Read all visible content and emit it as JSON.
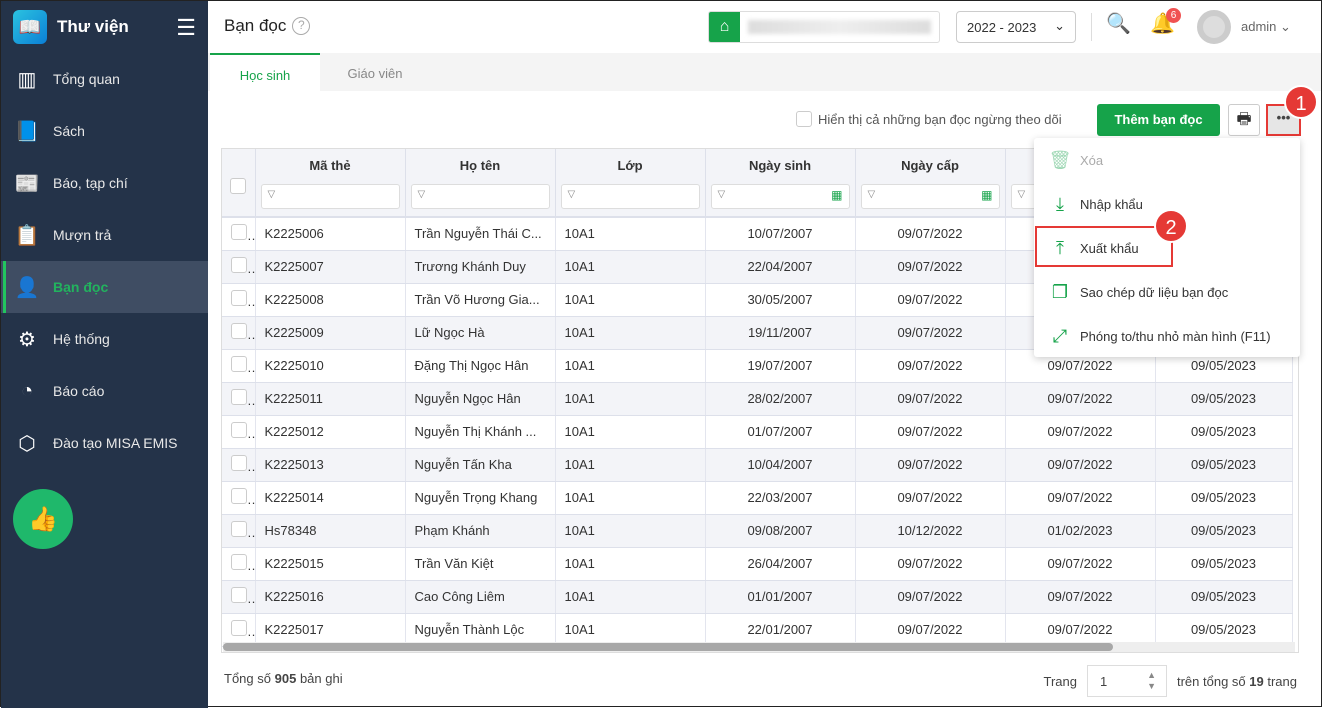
{
  "app": {
    "title": "Thư viện"
  },
  "sidebar": {
    "items": [
      {
        "label": "Tổng quan",
        "icon": "bar-chart-icon"
      },
      {
        "label": "Sách",
        "icon": "book-icon"
      },
      {
        "label": "Báo, tạp chí",
        "icon": "newspaper-icon"
      },
      {
        "label": "Mượn trả",
        "icon": "borrow-icon"
      },
      {
        "label": "Bạn đọc",
        "icon": "reader-icon",
        "active": true
      },
      {
        "label": "Hệ thống",
        "icon": "gear-icon"
      },
      {
        "label": "Báo cáo",
        "icon": "pie-chart-icon"
      },
      {
        "label": "Đào tạo MISA EMIS",
        "icon": "cube-icon"
      }
    ]
  },
  "header": {
    "title": "Bạn đọc",
    "year": "2022 - 2023",
    "notifications": "6",
    "user": "admin"
  },
  "tabs": [
    {
      "label": "Học sinh",
      "active": true
    },
    {
      "label": "Giáo viên"
    }
  ],
  "toolbar": {
    "show_inactive": "Hiển thị cả những bạn đọc ngừng theo dõi",
    "add": "Thêm bạn đọc",
    "more": "•••"
  },
  "annotations": {
    "step1": "1",
    "step2": "2"
  },
  "menu": [
    {
      "label": "Xóa",
      "icon": "trash-icon",
      "disabled": true
    },
    {
      "label": "Nhập khẩu",
      "icon": "import-icon"
    },
    {
      "label": "Xuất khẩu",
      "icon": "export-icon"
    },
    {
      "label": "Sao chép dữ liệu bạn đọc",
      "icon": "copy-icon"
    },
    {
      "label": "Phóng to/thu nhỏ màn hình (F11)",
      "icon": "expand-icon"
    }
  ],
  "table": {
    "columns": [
      "Mã thẻ",
      "Họ tên",
      "Lớp",
      "Ngày sinh",
      "Ngày cấp",
      "",
      ""
    ],
    "rows": [
      [
        "K2225006",
        "Trần Nguyễn Thái C...",
        "10A1",
        "10/07/2007",
        "09/07/2022",
        "",
        ""
      ],
      [
        "K2225007",
        "Trương Khánh Duy",
        "10A1",
        "22/04/2007",
        "09/07/2022",
        "",
        ""
      ],
      [
        "K2225008",
        "Trần Võ Hương Gia...",
        "10A1",
        "30/05/2007",
        "09/07/2022",
        "",
        ""
      ],
      [
        "K2225009",
        "Lữ Ngọc Hà",
        "10A1",
        "19/11/2007",
        "09/07/2022",
        "",
        ""
      ],
      [
        "K2225010",
        "Đặng Thị Ngọc Hân",
        "10A1",
        "19/07/2007",
        "09/07/2022",
        "09/07/2022",
        "09/05/2023"
      ],
      [
        "K2225011",
        "Nguyễn Ngọc Hân",
        "10A1",
        "28/02/2007",
        "09/07/2022",
        "09/07/2022",
        "09/05/2023"
      ],
      [
        "K2225012",
        "Nguyễn Thị Khánh ...",
        "10A1",
        "01/07/2007",
        "09/07/2022",
        "09/07/2022",
        "09/05/2023"
      ],
      [
        "K2225013",
        "Nguyễn Tấn Kha",
        "10A1",
        "10/04/2007",
        "09/07/2022",
        "09/07/2022",
        "09/05/2023"
      ],
      [
        "K2225014",
        "Nguyễn Trọng Khang",
        "10A1",
        "22/03/2007",
        "09/07/2022",
        "09/07/2022",
        "09/05/2023"
      ],
      [
        "Hs78348",
        "Phạm Khánh",
        "10A1",
        "09/08/2007",
        "10/12/2022",
        "01/02/2023",
        "09/05/2023"
      ],
      [
        "K2225015",
        "Trần Văn Kiệt",
        "10A1",
        "26/04/2007",
        "09/07/2022",
        "09/07/2022",
        "09/05/2023"
      ],
      [
        "K2225016",
        "Cao Công Liêm",
        "10A1",
        "01/01/2007",
        "09/07/2022",
        "09/07/2022",
        "09/05/2023"
      ],
      [
        "K2225017",
        "Nguyễn Thành Lộc",
        "10A1",
        "22/01/2007",
        "09/07/2022",
        "09/07/2022",
        "09/05/2023"
      ]
    ]
  },
  "footer": {
    "total_prefix": "Tổng số",
    "total": "905",
    "total_suffix": "bản ghi",
    "page_label": "Trang",
    "page": "1",
    "pages_prefix": "trên tổng số",
    "pages": "19",
    "pages_suffix": "trang"
  }
}
